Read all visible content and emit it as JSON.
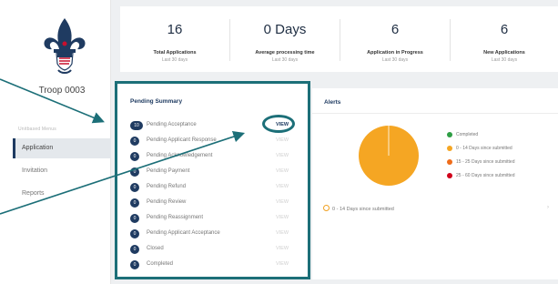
{
  "sidebar": {
    "troop_name": "Troop 0003",
    "nav_heading": "Unitbased Menus",
    "items": [
      {
        "label": "Application",
        "active": true
      },
      {
        "label": "Invitation",
        "active": false
      },
      {
        "label": "Reports",
        "active": false
      }
    ]
  },
  "stats": [
    {
      "value": "16",
      "label": "Total Applications",
      "sub": "Last 30 days"
    },
    {
      "value": "0 Days",
      "label": "Average processing time",
      "sub": "Last 30 days"
    },
    {
      "value": "6",
      "label": "Application in Progress",
      "sub": "Last 30 days"
    },
    {
      "value": "6",
      "label": "New Applications",
      "sub": "Last 30 days"
    }
  ],
  "pending_summary": {
    "title": "Pending Summary",
    "rows": [
      {
        "count": "10",
        "label": "Pending Acceptance",
        "action": "VIEW",
        "active": true
      },
      {
        "count": "0",
        "label": "Pending Applicant Response",
        "action": "VIEW",
        "active": false
      },
      {
        "count": "0",
        "label": "Pending Acknowledgement",
        "action": "VIEW",
        "active": false
      },
      {
        "count": "0",
        "label": "Pending Payment",
        "action": "VIEW",
        "active": false
      },
      {
        "count": "0",
        "label": "Pending Refund",
        "action": "VIEW",
        "active": false
      },
      {
        "count": "0",
        "label": "Pending Review",
        "action": "VIEW",
        "active": false
      },
      {
        "count": "0",
        "label": "Pending Reassignment",
        "action": "VIEW",
        "active": false
      },
      {
        "count": "0",
        "label": "Pending Applicant Acceptance",
        "action": "VIEW",
        "active": false
      },
      {
        "count": "0",
        "label": "Closed",
        "action": "VIEW",
        "active": false
      },
      {
        "count": "0",
        "label": "Completed",
        "action": "VIEW",
        "active": false
      }
    ]
  },
  "alerts": {
    "title": "Alerts",
    "legend": [
      {
        "label": "Completed",
        "color": "#2e9e44"
      },
      {
        "label": "0 - 14 Days since submitted",
        "color": "#f5a623"
      },
      {
        "label": "15 - 25 Days since submitted",
        "color": "#ef6c1a"
      },
      {
        "label": "25 - 60 Days since submitted",
        "color": "#d0021b"
      }
    ],
    "pie_color": "#f5a623",
    "row_label": "0 - 14 Days since submitted",
    "row_chevron": "›"
  },
  "colors": {
    "accent": "#1c6f78",
    "navy": "#1f3b61"
  }
}
